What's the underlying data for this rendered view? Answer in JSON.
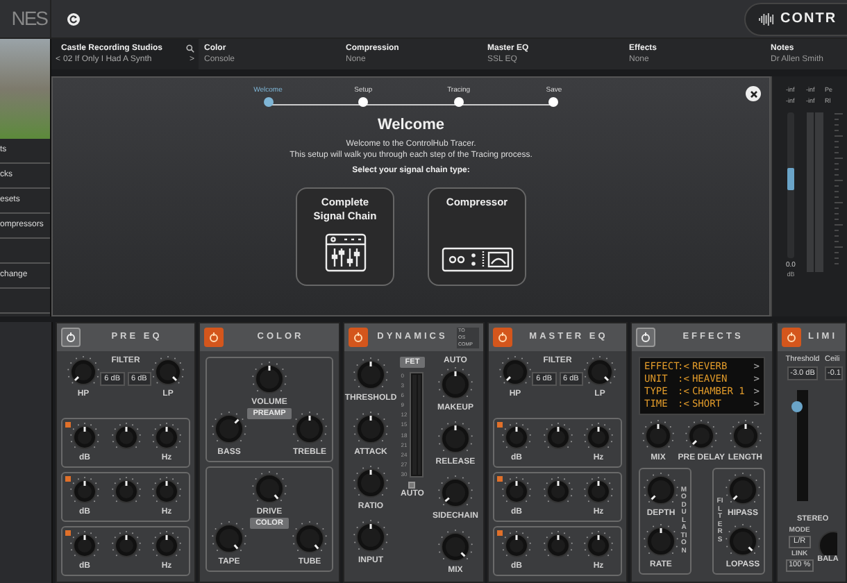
{
  "header": {
    "logo_text": "NES",
    "brand": "CONTR"
  },
  "session": {
    "studio": "Castle Recording Studios",
    "prev": "<",
    "track": "02 If Only I Had A Synth",
    "next": ">"
  },
  "chain": [
    {
      "label": "Color",
      "value": "Console"
    },
    {
      "label": "Compression",
      "value": "None"
    },
    {
      "label": "Master EQ",
      "value": "SSL EQ"
    },
    {
      "label": "Effects",
      "value": "None"
    },
    {
      "label": "Notes",
      "value": "Dr Allen Smith"
    }
  ],
  "sidebar": {
    "items": [
      {
        "label": "ts"
      },
      {
        "label": "cks"
      },
      {
        "label": "esets"
      },
      {
        "label": "ompressors"
      },
      {
        "label": "change"
      }
    ]
  },
  "wizard": {
    "steps": [
      {
        "label": "Welcome",
        "selected": true
      },
      {
        "label": "Setup",
        "selected": false
      },
      {
        "label": "Tracing",
        "selected": false
      },
      {
        "label": "Save",
        "selected": false
      }
    ],
    "title": "Welcome",
    "intro": [
      "Welcome to the ControlHub Tracer.",
      "This setup will walk you through each step of the Tracing process."
    ],
    "prompt": "Select your signal chain type:",
    "options": [
      {
        "kind": "console",
        "label": "Complete Signal Chain"
      },
      {
        "kind": "compressor",
        "label": "Compressor"
      }
    ]
  },
  "meter_panel": {
    "readings": [
      "-inf",
      "-inf",
      "-inf",
      "-inf"
    ],
    "side": [
      "Pe",
      "Rl"
    ],
    "fader": {
      "level": 0.55
    },
    "value": "0.0",
    "unit": "dB"
  },
  "modules": [
    {
      "kind": "eq",
      "title": "PRE EQ",
      "on": false,
      "filter": "FILTER",
      "slopes": [
        "6 dB",
        "6 dB"
      ],
      "filter_knobs": [
        "HP",
        "LP"
      ],
      "bands": [
        {
          "on": true,
          "low": "dB",
          "high": "Hz"
        },
        {
          "on": true,
          "low": "dB",
          "high": "Hz"
        },
        {
          "on": true,
          "low": "dB",
          "high": "Hz"
        }
      ]
    },
    {
      "kind": "color",
      "title": "COLOR",
      "on": true,
      "sections": [
        {
          "tag": "PREAMP",
          "top": "VOLUME",
          "left": "BASS",
          "right": "TREBLE"
        },
        {
          "tag": "COLOR",
          "top": "DRIVE",
          "left": "TAPE",
          "right": "TUBE"
        }
      ]
    },
    {
      "kind": "dynamics",
      "title": "DYNAMICS",
      "on": true,
      "modes": [
        {
          "label": "TO",
          "selected": false
        },
        {
          "label": "OS",
          "selected": false
        },
        {
          "label": "COMP",
          "selected": false
        }
      ],
      "type": "FET",
      "auto_top": "AUTO",
      "left_knobs": [
        "THRESHOLD",
        "ATTACK",
        "RATIO",
        "INPUT"
      ],
      "right_knobs": [
        "MAKEUP",
        "RELEASE",
        "SIDECHAIN",
        "MIX"
      ],
      "scale": [
        "0",
        "3",
        "6",
        "9",
        "12",
        "15",
        "18",
        "21",
        "24",
        "27",
        "30"
      ],
      "auto_bottom": {
        "label": "AUTO",
        "checked": false
      }
    },
    {
      "kind": "eq",
      "title": "MASTER EQ",
      "on": true,
      "filter": "FILTER",
      "slopes": [
        "6 dB",
        "6 dB"
      ],
      "filter_knobs": [
        "HP",
        "LP"
      ],
      "bands": [
        {
          "on": true,
          "low": "dB",
          "high": "Hz"
        },
        {
          "on": true,
          "low": "dB",
          "high": "Hz"
        },
        {
          "on": true,
          "low": "dB",
          "high": "Hz"
        }
      ]
    },
    {
      "kind": "effects",
      "title": "EFFECTS",
      "on": false,
      "display": [
        {
          "name": "EFFECT",
          "colon": ":",
          "prev": "<",
          "value": "REVERB",
          "next": ">"
        },
        {
          "name": "UNIT",
          "colon": ":",
          "prev": "<",
          "value": "HEAVEN",
          "next": ">"
        },
        {
          "name": "TYPE",
          "colon": ":",
          "prev": "<",
          "value": "CHAMBER 1",
          "next": ">"
        },
        {
          "name": "TIME",
          "colon": ":",
          "prev": "<",
          "value": "SHORT",
          "next": ">"
        }
      ],
      "knobs": [
        "MIX",
        "PRE DELAY",
        "LENGTH"
      ],
      "modulation": {
        "title": "MODULATION",
        "knobs": [
          "DEPTH",
          "RATE"
        ]
      },
      "filters": {
        "title": "FILTERS",
        "knobs": [
          "HIPASS",
          "LOPASS"
        ]
      }
    },
    {
      "kind": "limiter",
      "title": "LIMI",
      "on": true,
      "threshold": {
        "label": "Threshold",
        "value": "-3.0 dB",
        "level": 0.85
      },
      "ceiling": {
        "label": "Ceili",
        "value": "-0.1"
      },
      "stereo": "STEREO",
      "mode_label": "MODE",
      "mode": "L/R",
      "link_label": "LINK",
      "link": "100 %",
      "balance": "BALA"
    }
  ]
}
